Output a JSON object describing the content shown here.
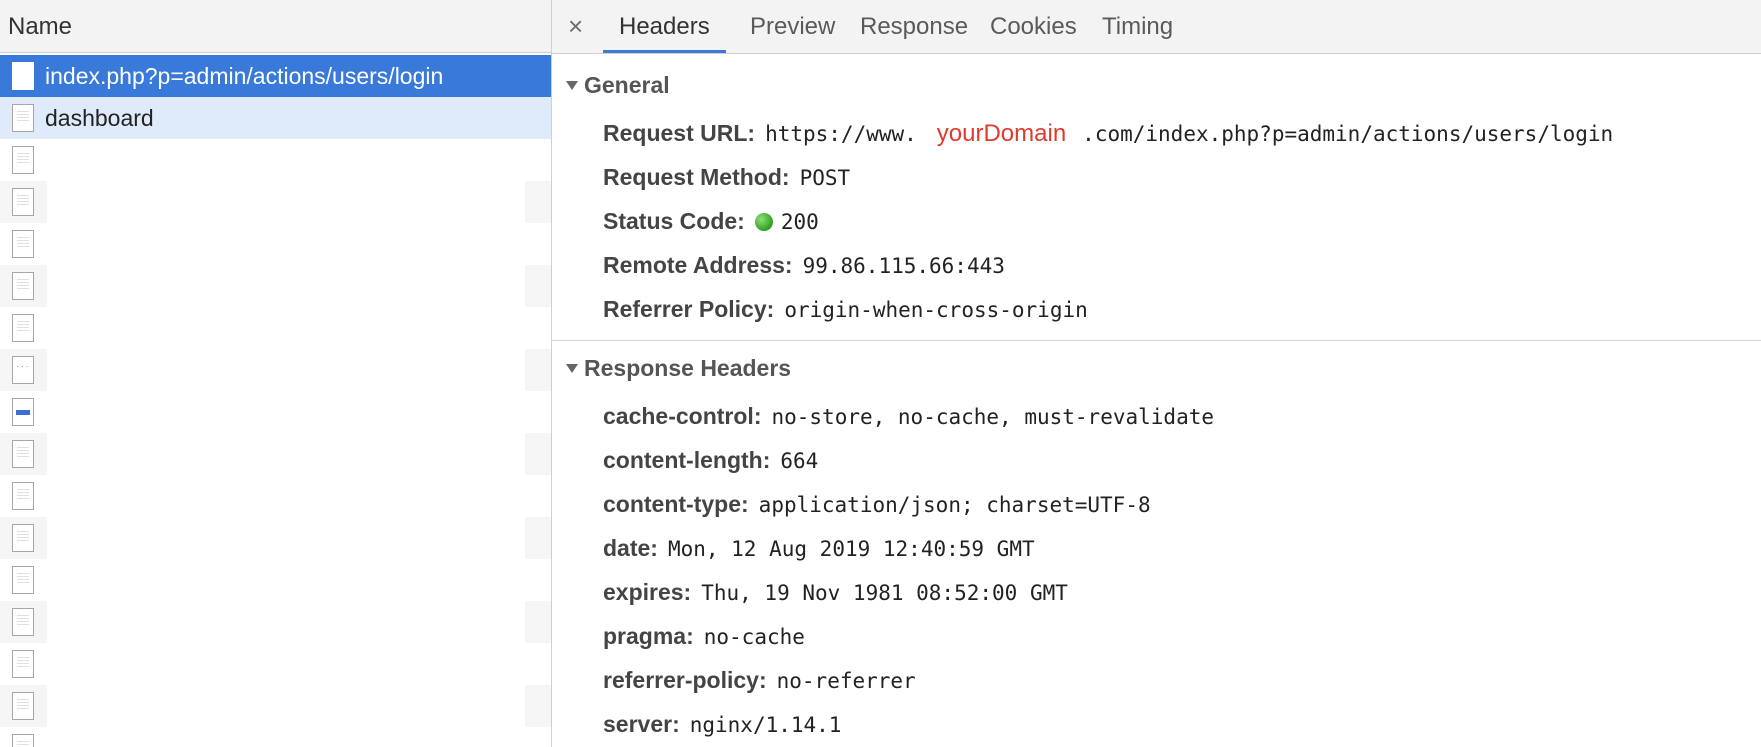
{
  "left_pane": {
    "header": "Name",
    "requests": [
      {
        "label": "index.php?p=admin/actions/users/login",
        "state": "selected"
      },
      {
        "label": "dashboard",
        "state": "sub"
      }
    ]
  },
  "tabs": {
    "close": "×",
    "items": [
      "Headers",
      "Preview",
      "Response",
      "Cookies",
      "Timing"
    ],
    "active": "Headers"
  },
  "general": {
    "title": "General",
    "request_url": {
      "key": "Request URL:",
      "prefix": "https://www.",
      "domain": "yourDomain",
      "suffix": ".com/index.php?p=admin/actions/users/login"
    },
    "request_method": {
      "key": "Request Method:",
      "value": "POST"
    },
    "status_code": {
      "key": "Status Code:",
      "value": "200"
    },
    "remote_address": {
      "key": "Remote Address:",
      "value": "99.86.115.66:443"
    },
    "referrer_policy": {
      "key": "Referrer Policy:",
      "value": "origin-when-cross-origin"
    }
  },
  "response_headers": {
    "title": "Response Headers",
    "items": [
      {
        "key": "cache-control:",
        "value": "no-store, no-cache, must-revalidate"
      },
      {
        "key": "content-length:",
        "value": "664"
      },
      {
        "key": "content-type:",
        "value": "application/json; charset=UTF-8"
      },
      {
        "key": "date:",
        "value": "Mon, 12 Aug 2019 12:40:59 GMT"
      },
      {
        "key": "expires:",
        "value": "Thu, 19 Nov 1981 08:52:00 GMT"
      },
      {
        "key": "pragma:",
        "value": "no-cache"
      },
      {
        "key": "referrer-policy:",
        "value": "no-referrer"
      },
      {
        "key": "server:",
        "value": "nginx/1.14.1"
      }
    ]
  },
  "colors": {
    "selected_row": "#3879d9",
    "sub_row": "#dfeafb",
    "domain_highlight": "#e03a2e",
    "status_ok": "#2e9e1f"
  }
}
